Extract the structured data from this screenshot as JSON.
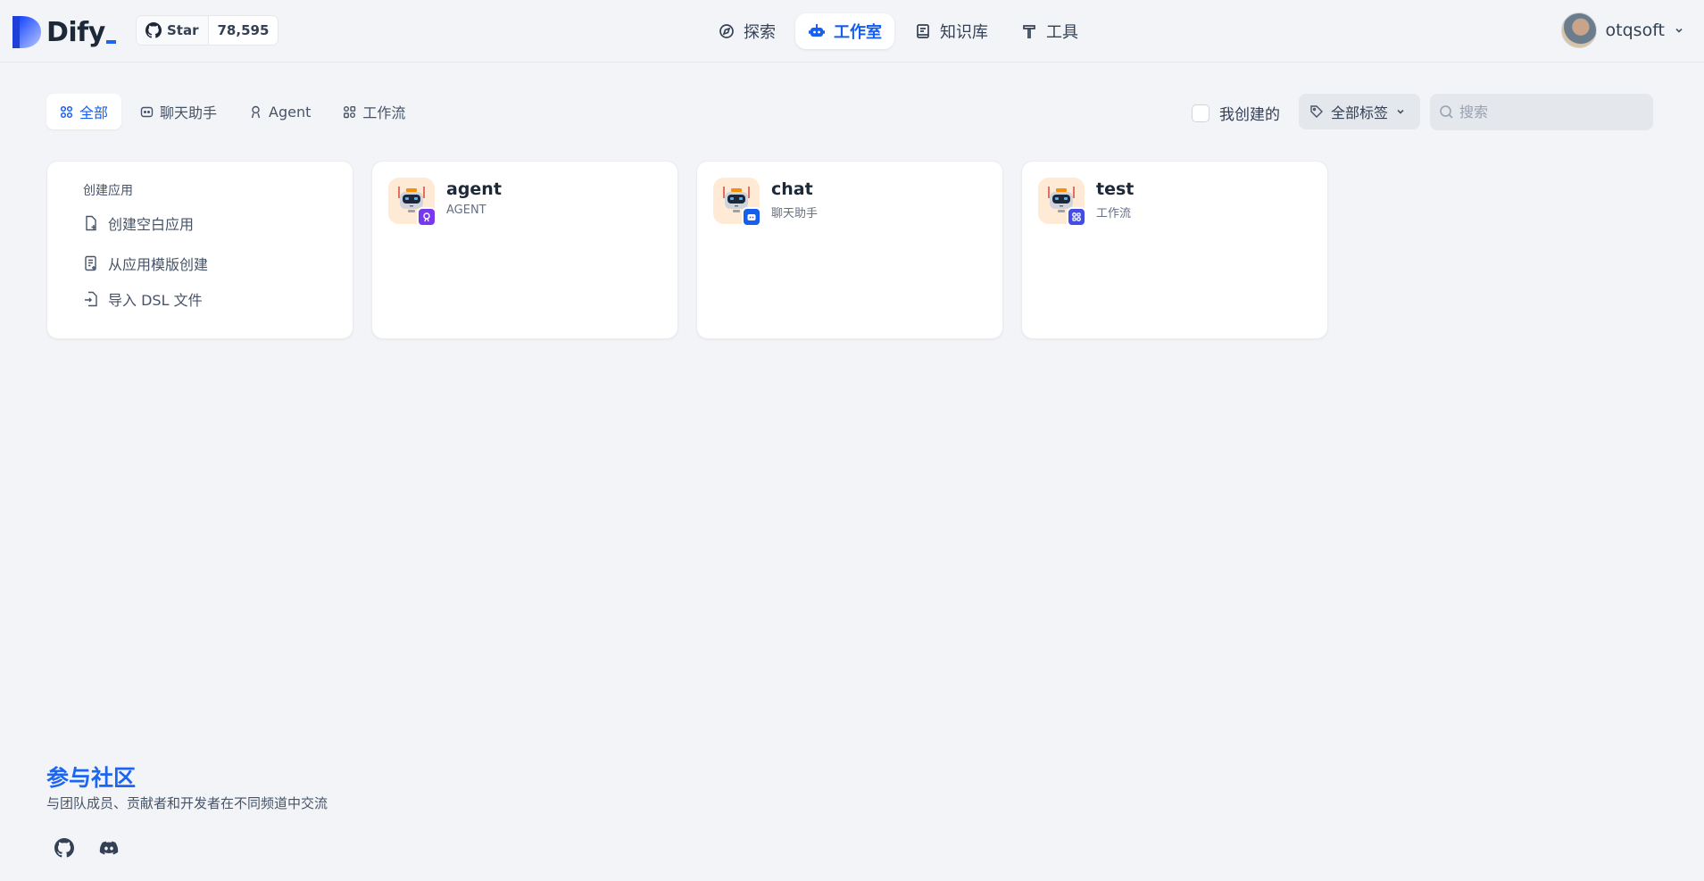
{
  "brand": {
    "name": "Dify"
  },
  "github": {
    "star_label": "Star",
    "star_count": "78,595"
  },
  "nav": [
    {
      "label": "探索",
      "icon": "explore-icon"
    },
    {
      "label": "工作室",
      "icon": "robot-icon",
      "active": true
    },
    {
      "label": "知识库",
      "icon": "book-icon"
    },
    {
      "label": "工具",
      "icon": "hammer-icon"
    }
  ],
  "user": {
    "name": "otqsoft"
  },
  "filters": {
    "tabs": [
      {
        "label": "全部",
        "active": true
      },
      {
        "label": "聊天助手"
      },
      {
        "label": "Agent"
      },
      {
        "label": "工作流"
      }
    ],
    "mine_label": "我创建的",
    "tag_label": "全部标签",
    "search_placeholder": "搜索"
  },
  "create": {
    "title": "创建应用",
    "items": [
      {
        "label": "创建空白应用"
      },
      {
        "label": "从应用模版创建"
      },
      {
        "label": "导入 DSL 文件"
      }
    ]
  },
  "apps": [
    {
      "name": "agent",
      "type": "AGENT",
      "badge_color": "#7839ee"
    },
    {
      "name": "chat",
      "type": "聊天助手",
      "badge_color": "#155eef"
    },
    {
      "name": "test",
      "type": "工作流",
      "badge_color": "#444ce7"
    }
  ],
  "community": {
    "title": "参与社区",
    "subtitle": "与团队成员、贡献者和开发者在不同频道中交流"
  },
  "colors": {
    "primary": "#155eef",
    "accent": "#1c64f2",
    "background": "#f2f4f7"
  }
}
